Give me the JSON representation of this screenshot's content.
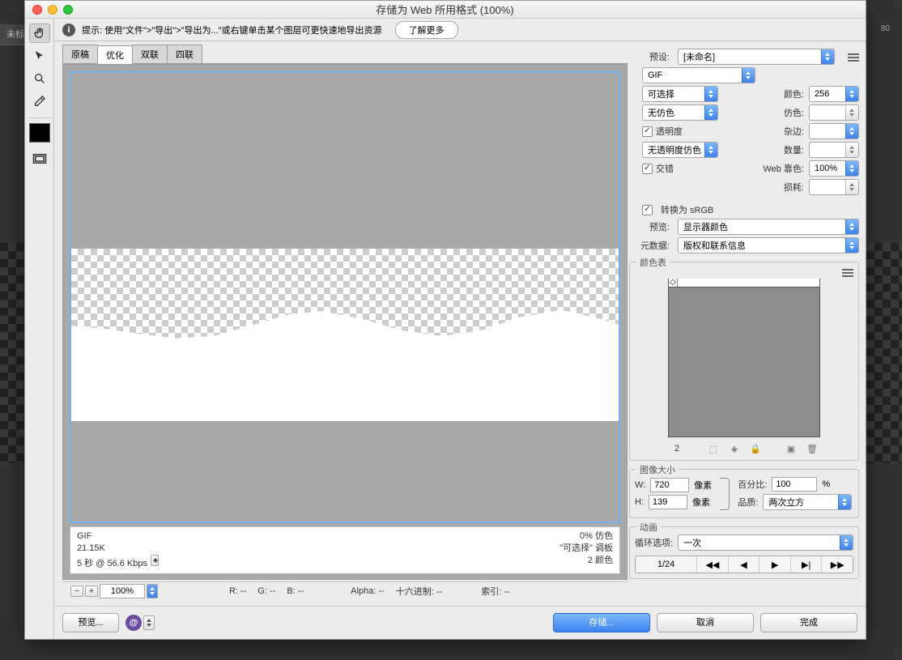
{
  "bgTab": "未标题",
  "bgInfo": "80",
  "window": {
    "title": "存储为 Web 所用格式 (100%)"
  },
  "hint": {
    "text": "提示: 使用\"文件\">\"导出\">\"导出为...\"或右键单击某个图层可更快速地导出资源",
    "learnMore": "了解更多"
  },
  "tabs": [
    "原稿",
    "优化",
    "双联",
    "四联"
  ],
  "activeTab": 1,
  "infoLeft": {
    "l1": "GIF",
    "l2": "21.15K",
    "l3": "5 秒 @ 56.6 Kbps"
  },
  "infoRight": {
    "l1": "0% 仿色",
    "l2": "\"可选择\" 调板",
    "l3": "2 颜色"
  },
  "status": {
    "zoom": "100%",
    "r": "R: --",
    "g": "G: --",
    "b": "B: --",
    "alpha": "Alpha: --",
    "hex": "十六进制: --",
    "index": "索引: --"
  },
  "buttons": {
    "preview": "预览...",
    "save": "存储...",
    "cancel": "取消",
    "done": "完成"
  },
  "preset": {
    "label": "预设:",
    "value": "[未命名]"
  },
  "fmt": {
    "format": "GIF",
    "reduction": "可选择",
    "dither": "无仿色",
    "colorsLabel": "颜色:",
    "colorsVal": "256",
    "ditherLabel": "仿色:",
    "transparency": "透明度",
    "matteLabel": "杂边:",
    "transDither": "无透明度仿色",
    "amountLabel": "数量:",
    "interlace": "交错",
    "webSnapLabel": "Web 靠色:",
    "webSnapVal": "100%",
    "lossyLabel": "损耗:"
  },
  "convert": {
    "srgb": "转换为 sRGB",
    "previewLabel": "预览:",
    "previewVal": "显示器颜色",
    "metaLabel": "元数据:",
    "metaVal": "版权和联系信息"
  },
  "colorTable": {
    "title": "颜色表",
    "count": "2"
  },
  "imageSize": {
    "title": "图像大小",
    "wLabel": "W:",
    "wVal": "720",
    "wUnit": "像素",
    "hLabel": "H:",
    "hVal": "139",
    "hUnit": "像素",
    "pctLabel": "百分比:",
    "pctVal": "100",
    "pctUnit": "%",
    "qLabel": "品质:",
    "qVal": "两次立方"
  },
  "anim": {
    "title": "动画",
    "loopLabel": "循环选项:",
    "loopVal": "一次",
    "frame": "1/24"
  }
}
